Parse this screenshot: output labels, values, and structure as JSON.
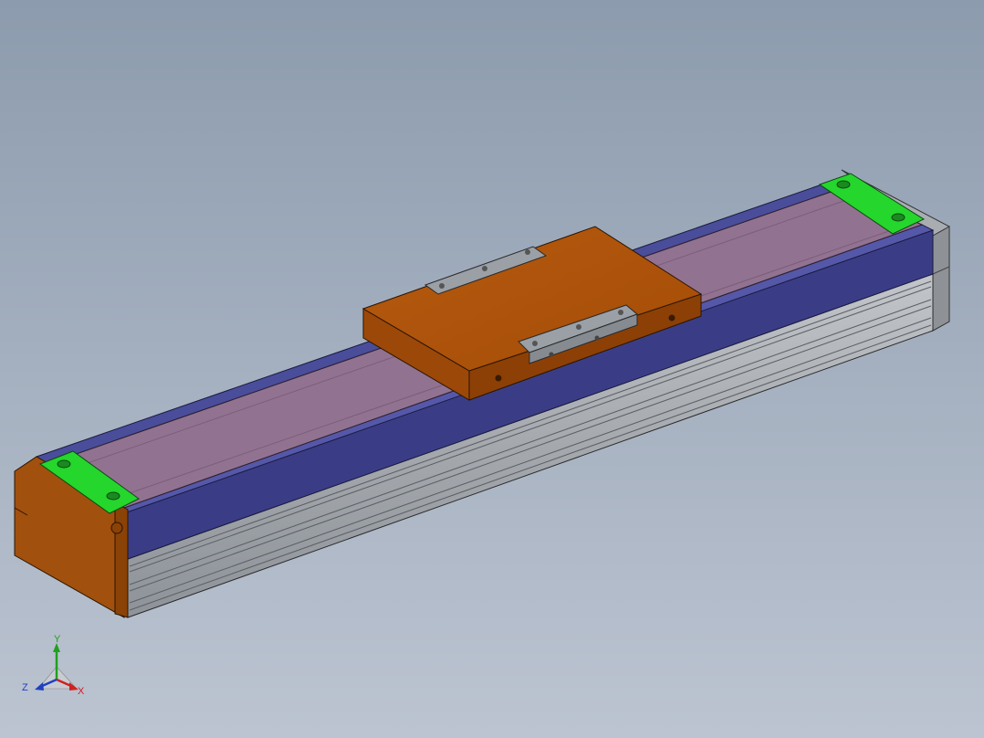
{
  "viewport": {
    "background_top": "#8c9bad",
    "background_bottom": "#bcc4d1"
  },
  "model": {
    "parts": [
      "aluminum-profile-body",
      "blue-side-cover",
      "purple-top-cover",
      "orange-carriage",
      "orange-end-cap",
      "green-end-brackets",
      "steel-clamp-plates"
    ],
    "colors": {
      "aluminum": "#aeb2b6",
      "blue_cover": "#3a3d86",
      "purple_cover": "#927291",
      "orange": "#a8500a",
      "green": "#25d62d",
      "steel": "#9aa0a6"
    }
  },
  "triad": {
    "x_label": "X",
    "y_label": "Y",
    "z_label": "Z",
    "x_color": "#d02020",
    "y_color": "#20a020",
    "z_color": "#2040c0"
  }
}
